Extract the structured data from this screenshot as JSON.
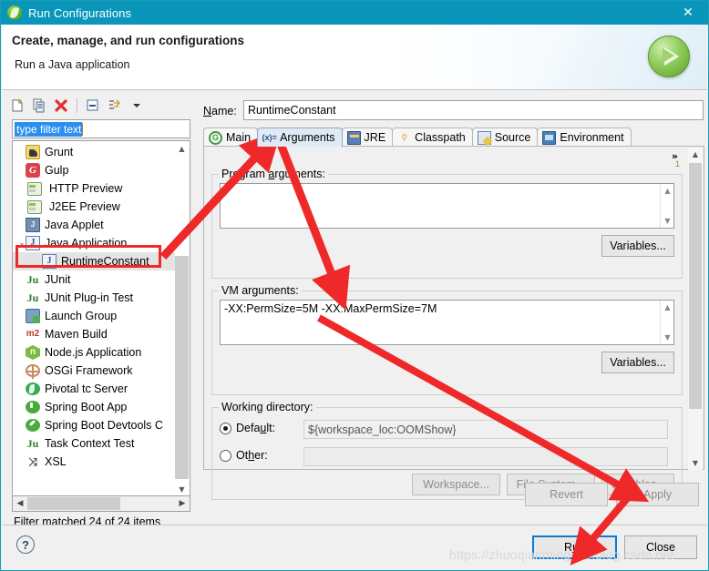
{
  "window": {
    "title": "Run Configurations",
    "title_icon": "spring-leaf-icon",
    "close_icon": "✕"
  },
  "header": {
    "title": "Create, manage, and run configurations",
    "subtitle": "Run a Java application",
    "run_orb_icon": "play-icon"
  },
  "left_panel": {
    "toolbar": [
      {
        "name": "new-configuration-icon",
        "glyph": "new"
      },
      {
        "name": "duplicate-configuration-icon",
        "glyph": "duplicate"
      },
      {
        "name": "delete-configuration-icon",
        "glyph": "✕"
      },
      {
        "name": "collapse-all-icon",
        "glyph": "collapse"
      },
      {
        "name": "filter-icon",
        "glyph": "filter"
      },
      {
        "name": "view-menu-chevron-down-icon",
        "glyph": "▼"
      }
    ],
    "filter": {
      "value": "type filter text",
      "placeholder": "type filter text"
    },
    "tree": [
      {
        "label": "Grunt",
        "icon": "ic-grunt",
        "indent": 0,
        "twisty": "",
        "selected": false
      },
      {
        "label": "Gulp",
        "icon": "ic-gulp",
        "indent": 0,
        "twisty": "",
        "selected": false,
        "glyph": "G"
      },
      {
        "label": "HTTP Preview",
        "icon": "ic-server",
        "indent": 0,
        "twisty": "",
        "selected": false
      },
      {
        "label": "J2EE Preview",
        "icon": "ic-server",
        "indent": 0,
        "twisty": "",
        "selected": false
      },
      {
        "label": "Java Applet",
        "icon": "ic-japplet",
        "indent": 0,
        "twisty": "",
        "selected": false,
        "glyph": "J"
      },
      {
        "label": "Java Application",
        "icon": "ic-japp",
        "indent": 0,
        "twisty": "⌄",
        "selected": false,
        "glyph": "J"
      },
      {
        "label": "RuntimeConstant",
        "icon": "ic-japp",
        "indent": 1,
        "twisty": "",
        "selected": true,
        "glyph": "J"
      },
      {
        "label": "JUnit",
        "icon": "ic-junit",
        "indent": 0,
        "twisty": "",
        "selected": false,
        "glyph": "Ju"
      },
      {
        "label": "JUnit Plug-in Test",
        "icon": "ic-junitp",
        "indent": 0,
        "twisty": "",
        "selected": false,
        "glyph": "Ju"
      },
      {
        "label": "Launch Group",
        "icon": "ic-launch",
        "indent": 0,
        "twisty": "",
        "selected": false
      },
      {
        "label": "Maven Build",
        "icon": "ic-maven",
        "indent": 0,
        "twisty": "",
        "selected": false,
        "glyph": "m2"
      },
      {
        "label": "Node.js Application",
        "icon": "ic-node",
        "indent": 0,
        "twisty": "",
        "selected": false,
        "glyph": "n"
      },
      {
        "label": "OSGi Framework",
        "icon": "ic-osgi",
        "indent": 0,
        "twisty": "",
        "selected": false
      },
      {
        "label": "Pivotal tc Server",
        "icon": "ic-pivotal",
        "indent": 0,
        "twisty": "",
        "selected": false
      },
      {
        "label": "Spring Boot App",
        "icon": "ic-sboot",
        "indent": 0,
        "twisty": "",
        "selected": false
      },
      {
        "label": "Spring Boot Devtools C",
        "icon": "ic-sbootd",
        "indent": 0,
        "twisty": "",
        "selected": false
      },
      {
        "label": "Task Context Test",
        "icon": "ic-task",
        "indent": 0,
        "twisty": "",
        "selected": false,
        "glyph": "Ju"
      },
      {
        "label": "XSL",
        "icon": "ic-xsl",
        "indent": 0,
        "twisty": "",
        "selected": false,
        "glyph": "⤨"
      }
    ],
    "status": "Filter matched 24 of 24 items"
  },
  "right_panel": {
    "name_label": "Name:",
    "name_value": "RuntimeConstant",
    "tabs": [
      {
        "label": "Main",
        "icon": "main-tab-icon",
        "active": false
      },
      {
        "label": "Arguments",
        "icon": "arguments-tab-icon",
        "active": true,
        "prefix": "(x)="
      },
      {
        "label": "JRE",
        "icon": "jre-tab-icon",
        "active": false
      },
      {
        "label": "Classpath",
        "icon": "classpath-tab-icon",
        "active": false
      },
      {
        "label": "Source",
        "icon": "source-tab-icon",
        "active": false
      },
      {
        "label": "Environment",
        "icon": "environment-tab-icon",
        "active": false
      }
    ],
    "overflow_indicator": "»",
    "overflow_count": "1",
    "program_arguments": {
      "label": "Program arguments:",
      "value": "",
      "variables_button": "Variables..."
    },
    "vm_arguments": {
      "label": "VM arguments:",
      "value": "-XX:PermSize=5M -XX:MaxPermSize=7M",
      "variables_button": "Variables..."
    },
    "working_directory": {
      "label": "Working directory:",
      "default_radio": "Default:",
      "default_value": "${workspace_loc:OOMShow}",
      "default_selected": true,
      "other_radio": "Other:",
      "other_value": "",
      "other_selected": false,
      "buttons": [
        "Workspace...",
        "File System...",
        "Variables..."
      ]
    },
    "revert_button": "Revert",
    "apply_button": "Apply"
  },
  "footer": {
    "help_icon": "?",
    "run_button": "Run",
    "close_button": "Close",
    "watermark": "https://zhuoqianmingyue.blog.csdn.net"
  },
  "annotations": {
    "highlight_color": "#ef2929",
    "arrows": [
      {
        "name": "arrow-tree-to-arguments-tab"
      },
      {
        "name": "arrow-arguments-tab-to-vm-arguments"
      },
      {
        "name": "arrow-vm-arguments-to-apply"
      },
      {
        "name": "arrow-apply-to-run"
      }
    ],
    "box": {
      "name": "runtime-constant-highlight-box"
    }
  }
}
